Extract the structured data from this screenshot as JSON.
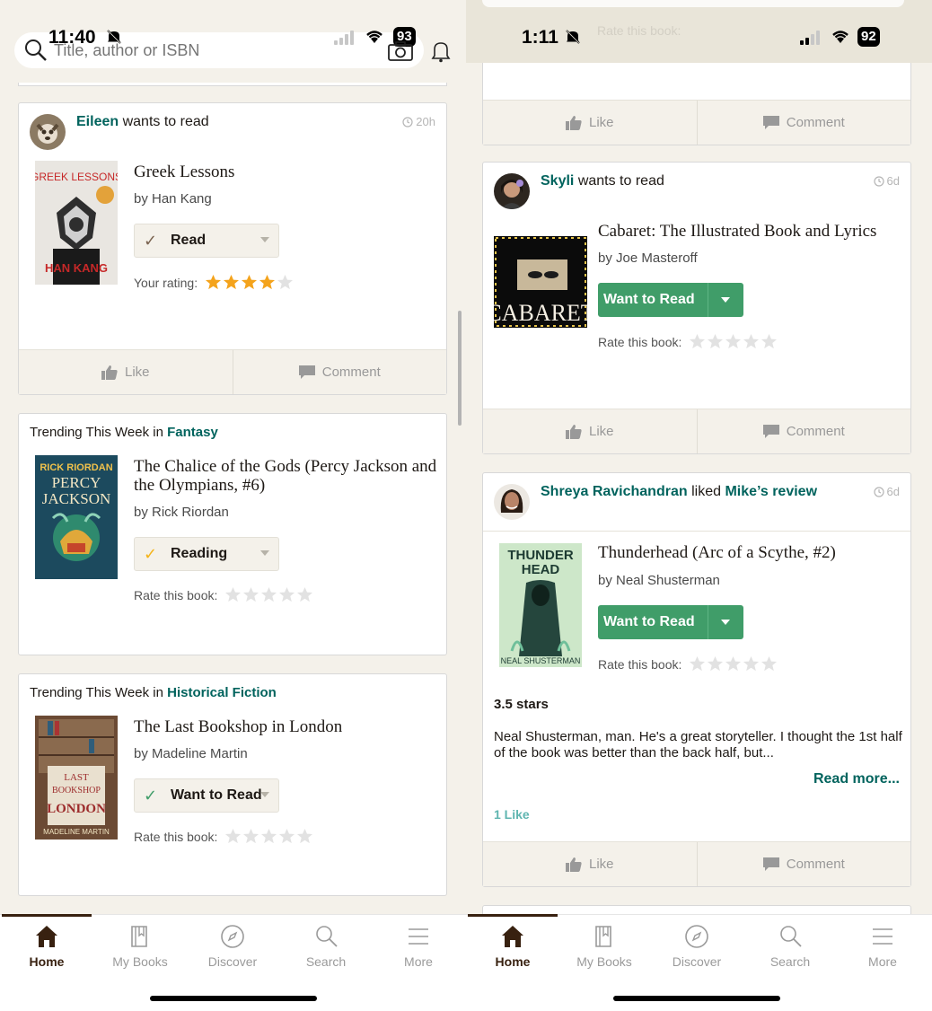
{
  "left": {
    "status": {
      "time": "11:40",
      "battery": "93"
    },
    "search": {
      "placeholder": "Title, author or ISBN"
    },
    "card1": {
      "user": "Eileen",
      "action": "wants to read",
      "time": "20h",
      "book": {
        "title": "Greek Lessons",
        "author": "by Han Kang",
        "cover_title": "GREEK LESSONS",
        "cover_author": "HAN KANG"
      },
      "shelf": "Read",
      "rating_label": "Your rating:",
      "rating": 4
    },
    "card2": {
      "prefix": "Trending This Week in",
      "genre": "Fantasy",
      "book": {
        "title": "The Chalice of the Gods (Percy Jackson and the Olympians, #6)",
        "author": "by Rick Riordan",
        "cover_author": "RICK RIORDAN",
        "cover_title1": "PERCY",
        "cover_title2": "JACKSON"
      },
      "shelf": "Reading",
      "rate_label": "Rate this book:"
    },
    "card3": {
      "prefix": "Trending This Week in",
      "genre": "Historical Fiction",
      "book": {
        "title": "The Last Bookshop in London",
        "author": "by Madeline Martin",
        "cover_t1": "LAST",
        "cover_t2": "BOOKSHOP",
        "cover_t3": "LONDON",
        "cover_author": "MADELINE MARTIN"
      },
      "shelf": "Want to Read",
      "rate_label": "Rate this book:"
    }
  },
  "right": {
    "status": {
      "time": "1:11",
      "battery": "92"
    },
    "ghost_rate": "Rate this book:",
    "card0": {},
    "card1": {
      "user": "Skyli",
      "action": "wants to read",
      "time": "6d",
      "book": {
        "title": "Cabaret: The Illustrated Book and Lyrics",
        "author": "by Joe Masteroff",
        "cover_title": "CABARET"
      },
      "button": "Want to Read",
      "rate_label": "Rate this book:"
    },
    "card2": {
      "user": "Shreya Ravichandran",
      "action": "liked",
      "target": "Mike’s review",
      "time": "6d",
      "book": {
        "title": "Thunderhead (Arc of a Scythe, #2)",
        "author": "by Neal Shusterman",
        "cover_t1": "THUNDER",
        "cover_t2": "HEAD",
        "cover_author": "NEAL SHUSTERMAN"
      },
      "button": "Want to Read",
      "rate_label": "Rate this book:",
      "review_rating": "3.5 stars",
      "review_text": "Neal Shusterman, man. He's a great storyteller. I thought the 1st half of the book was better than the back half, but...",
      "read_more": "Read more...",
      "likes": "1 Like"
    }
  },
  "actions": {
    "like": "Like",
    "comment": "Comment"
  },
  "nav": {
    "home": "Home",
    "my_books": "My Books",
    "discover": "Discover",
    "search": "Search",
    "more": "More"
  },
  "colors": {
    "green": "#409d69",
    "link": "#00635d",
    "star": "#f4a31c",
    "beige": "#f4f1ea",
    "brown": "#382110"
  },
  "icons": [
    "search-icon",
    "camera-icon",
    "bell-icon",
    "clock-icon",
    "thumbs-up-icon",
    "comment-icon",
    "home-icon",
    "my-books-icon",
    "discover-icon",
    "search-icon",
    "more-icon",
    "star-icon"
  ]
}
